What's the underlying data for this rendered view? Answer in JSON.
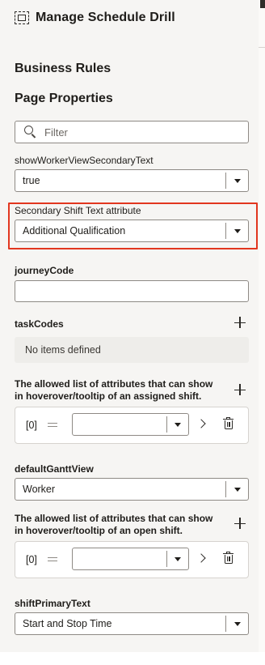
{
  "header": {
    "title": "Manage Schedule Drill",
    "icon": "layout-frame-icon"
  },
  "sections": {
    "business_rules": "Business Rules",
    "page_properties": "Page Properties"
  },
  "filter": {
    "placeholder": "Filter"
  },
  "fields": {
    "show_worker_view_secondary_text": {
      "label": "showWorkerViewSecondaryText",
      "value": "true"
    },
    "secondary_shift_text_attribute": {
      "label": "Secondary Shift Text attribute",
      "value": "Additional Qualification"
    },
    "journey_code": {
      "label": "journeyCode",
      "value": ""
    },
    "task_codes": {
      "label": "taskCodes",
      "empty_text": "No items defined"
    },
    "assigned_shift_attributes": {
      "label": "The allowed list of attributes that can show in hoverover/tooltip of an assigned shift.",
      "items": [
        {
          "index": "[0]",
          "value": ""
        }
      ]
    },
    "default_gantt_view": {
      "label": "defaultGanttView",
      "value": "Worker"
    },
    "open_shift_attributes": {
      "label": "The allowed list of attributes that can show in hoverover/tooltip of an open shift.",
      "items": [
        {
          "index": "[0]",
          "value": ""
        }
      ]
    },
    "shift_primary_text": {
      "label": "shiftPrimaryText",
      "value": "Start and Stop Time"
    }
  },
  "colors": {
    "highlight": "#e2361f",
    "panel": "#f6f5f3"
  }
}
